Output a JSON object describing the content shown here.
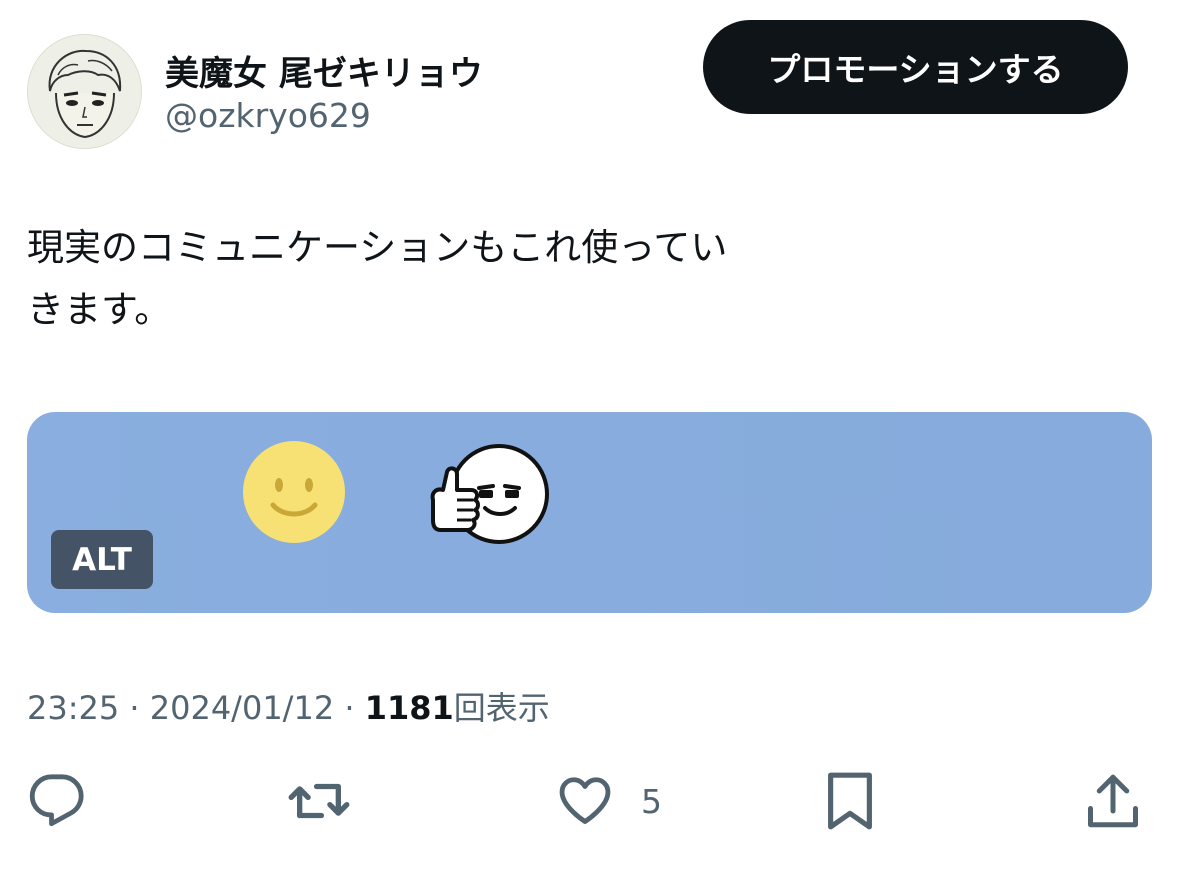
{
  "author": {
    "display_name": "美魔女 尾ゼキリョウ",
    "handle": "@ozkryo629"
  },
  "promote_button_label": "プロモーションする",
  "tweet": {
    "text_line1": "現実のコミュニケーションもこれ使ってい",
    "text_line2": "きます。"
  },
  "media": {
    "background_color": "#87acdd",
    "alt_badge": "ALT"
  },
  "meta": {
    "time": "23:25",
    "date": "2024/01/12",
    "separator": "·",
    "views_count": "1181",
    "views_label": "回表示"
  },
  "actions": {
    "reply_icon": "reply-icon",
    "retweet_icon": "retweet-icon",
    "like_icon": "heart-icon",
    "like_count": "5",
    "bookmark_icon": "bookmark-icon",
    "share_icon": "share-icon"
  },
  "colors": {
    "text_primary": "#0f1419",
    "text_secondary": "#536471",
    "button_bg": "#0f1419",
    "alt_badge_bg": "#455366"
  }
}
